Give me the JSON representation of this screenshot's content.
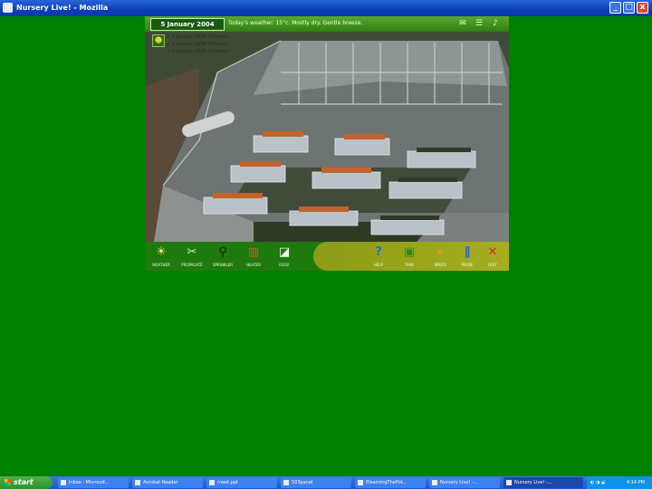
{
  "window": {
    "title": "Nursery Live! - Mozilla",
    "controls": {
      "minimize": "_",
      "maximize": "□",
      "close": "x"
    }
  },
  "game": {
    "date": "5 January 2004",
    "weather_text": "Today's weather: 15°c. Mostly dry. Gentle breeze.",
    "top_icons": [
      {
        "name": "hint-icon",
        "glyph": "✉"
      },
      {
        "name": "map-icon",
        "glyph": "☰"
      },
      {
        "name": "volume-icon",
        "glyph": "♪"
      }
    ],
    "log": [
      "> 5 January 2004 (0 items)",
      "> 4 January 2004 (0 items)",
      "> 3 January 2004 (0 items)"
    ],
    "toolbar_left": [
      {
        "label": "WEATHER",
        "icon": "weather-icon",
        "glyph": "☀",
        "color": "#f3e06a"
      },
      {
        "label": "PROPAGATE",
        "icon": "propagate-icon",
        "glyph": "✂",
        "color": "#d8e8c0"
      },
      {
        "label": "SPRINKLER",
        "icon": "sprinkler-icon",
        "glyph": "⚲",
        "color": "#1a1a1a"
      },
      {
        "label": "HEATER",
        "icon": "heater-icon",
        "glyph": "▥",
        "color": "#e6501f"
      },
      {
        "label": "ROOF",
        "icon": "roof-icon",
        "glyph": "◪",
        "color": "#f2f2f2"
      }
    ],
    "toolbar_right": [
      {
        "label": "HELP",
        "icon": "help-icon",
        "glyph": "?",
        "color": "#1d6fd6"
      },
      {
        "label": "TASK",
        "icon": "task-icon",
        "glyph": "▣",
        "color": "#2a8a2a"
      },
      {
        "label": "SPEED",
        "icon": "speed-icon",
        "glyph": "»",
        "color": "#d9a21a"
      },
      {
        "label": "PAUSE",
        "icon": "pause-icon",
        "glyph": "∥",
        "color": "#1d5fc6"
      },
      {
        "label": "QUIT",
        "icon": "quit-icon",
        "glyph": "✕",
        "color": "#d8231a"
      }
    ]
  },
  "taskbar": {
    "start_label": "start",
    "buttons": [
      {
        "label": "Inbox - Microsof...",
        "active": false
      },
      {
        "label": "Acrobat Reader",
        "active": false
      },
      {
        "label": "meet.ppt",
        "active": false
      },
      {
        "label": "503panel",
        "active": false
      },
      {
        "label": "ElearningThePot...",
        "active": false
      },
      {
        "label": "Nursery Live! -...",
        "active": false
      },
      {
        "label": "Nursery Live! -...",
        "active": true
      }
    ],
    "clock": "4:14 PM"
  },
  "colors": {
    "desktop": "#008000",
    "hud_green": "#2f7f14",
    "accent_olive": "#a8ad20"
  }
}
